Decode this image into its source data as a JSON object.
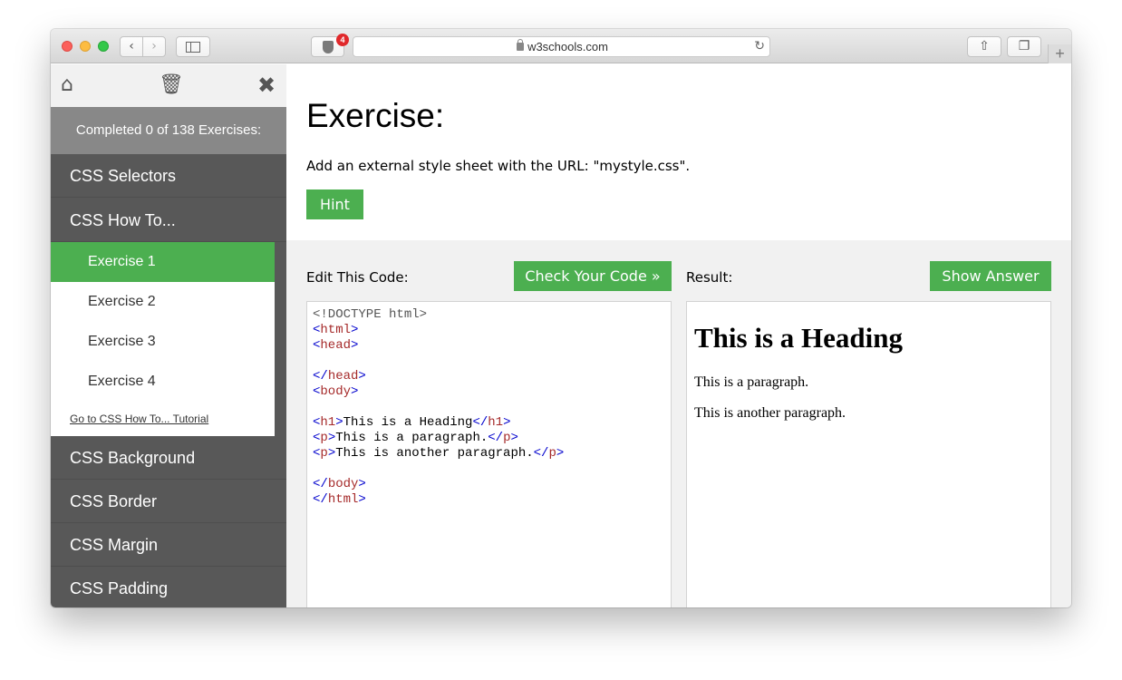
{
  "browser": {
    "url": "w3schools.com",
    "extension_badge": "4",
    "icons": {
      "back": "chevron-left-icon",
      "forward": "chevron-right-icon",
      "sidebar": "sidebar-icon",
      "extension": "ublock-shield-icon",
      "reload": "reload-icon",
      "share": "share-icon",
      "tabs": "tabs-icon",
      "new_tab": "plus-icon"
    }
  },
  "sidebar": {
    "toolbar_icons": [
      "home-icon",
      "trash-icon",
      "close-icon"
    ],
    "progress": "Completed 0 of 138 Exercises:",
    "sections": [
      {
        "label": "CSS Selectors"
      },
      {
        "label": "CSS How To..."
      },
      {
        "label": "CSS Background"
      },
      {
        "label": "CSS Border"
      },
      {
        "label": "CSS Margin"
      },
      {
        "label": "CSS Padding"
      }
    ],
    "sub_items": [
      {
        "label": "Exercise 1",
        "active": true
      },
      {
        "label": "Exercise 2",
        "active": false
      },
      {
        "label": "Exercise 3",
        "active": false
      },
      {
        "label": "Exercise 4",
        "active": false
      }
    ],
    "tutorial_link": "Go to CSS How To... Tutorial"
  },
  "exercise": {
    "title": "Exercise:",
    "description": "Add an external style sheet with the URL: \"mystyle.css\".",
    "hint_label": "Hint",
    "edit_label": "Edit This Code:",
    "check_label": "Check Your Code »",
    "result_label": "Result:",
    "answer_label": "Show Answer"
  },
  "code": {
    "doctype": "<!DOCTYPE html>",
    "open_html": "html",
    "open_head": "head",
    "close_head": "head",
    "open_body": "body",
    "h1_tag": "h1",
    "h1_text": "This is a Heading",
    "p_tag": "p",
    "p1_text": "This is a paragraph.",
    "p2_text": "This is another paragraph.",
    "close_body": "body",
    "close_html": "html"
  },
  "result": {
    "heading": "This is a Heading",
    "p1": "This is a paragraph.",
    "p2": "This is another paragraph."
  },
  "colors": {
    "accent_green": "#4caf50",
    "sidebar_dark": "#585858",
    "code_bracket": "#0000cd",
    "code_tag": "#a52a2a"
  }
}
